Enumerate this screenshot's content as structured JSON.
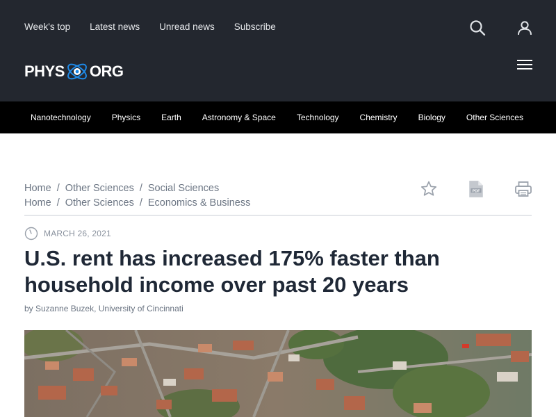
{
  "header": {
    "top_links": [
      "Week's top",
      "Latest news",
      "Unread news",
      "Subscribe"
    ],
    "logo": {
      "left": "PHYS",
      "right": "ORG",
      "separator": "·"
    },
    "icons": {
      "search": "search-icon",
      "user": "user-icon",
      "menu": "hamburger-menu-icon"
    }
  },
  "nav": {
    "categories": [
      "Nanotechnology",
      "Physics",
      "Earth",
      "Astronomy & Space",
      "Technology",
      "Chemistry",
      "Biology",
      "Other Sciences"
    ]
  },
  "breadcrumbs": [
    [
      "Home",
      "Other Sciences",
      "Social Sciences"
    ],
    [
      "Home",
      "Other Sciences",
      "Economics & Business"
    ]
  ],
  "breadcrumb_separator": "/",
  "tools": {
    "bookmark": "star-icon",
    "pdf": "pdf-icon",
    "print": "printer-icon"
  },
  "article": {
    "date": "MARCH 26, 2021",
    "title": "U.S. rent has increased 175% faster than household income over past 20 years",
    "byline": "by Suzanne Buzek, University of Cincinnati"
  },
  "colors": {
    "header_bg": "#23272f",
    "nav_bg": "#000000",
    "headline": "#1f2836",
    "muted": "#6b7583",
    "logo_accent": "#1e88e5"
  }
}
